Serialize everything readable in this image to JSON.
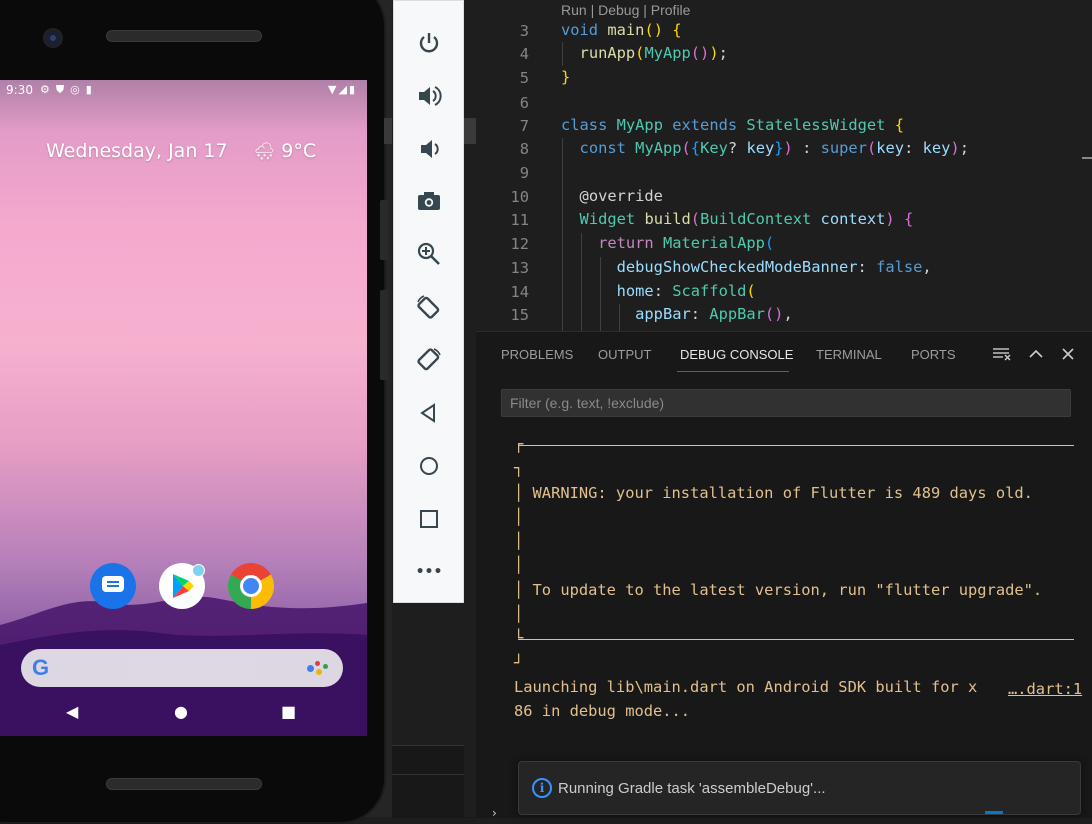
{
  "phone": {
    "status_bar": {
      "time": "9:30",
      "left_icons": [
        "settings-icon",
        "shield-icon",
        "sync-icon",
        "sdcard-icon"
      ],
      "right_icons": [
        "wifi-icon",
        "signal-icon",
        "battery-icon"
      ]
    },
    "date_text": "Wednesday, Jan 17",
    "weather_temp": "9°C",
    "weather_icon": "snow-cloud-icon",
    "dock_apps": [
      "Messages",
      "Play Store",
      "Chrome"
    ],
    "search_logo": "G",
    "nav_back": "◀",
    "nav_home": "●",
    "nav_recents": "■"
  },
  "emulator_toolbar": {
    "minimize": "−",
    "close": "×",
    "buttons": [
      "power",
      "volume-up",
      "volume-down",
      "screenshot",
      "zoom",
      "rotate-left",
      "rotate-right",
      "back",
      "home",
      "overview",
      "more"
    ],
    "more_label": "•••"
  },
  "editor": {
    "codelens": "Run | Debug | Profile",
    "lines": [
      {
        "n": "3"
      },
      {
        "n": "4"
      },
      {
        "n": "5"
      },
      {
        "n": "6"
      },
      {
        "n": "7"
      },
      {
        "n": "8"
      },
      {
        "n": "9"
      },
      {
        "n": "10"
      },
      {
        "n": "11"
      },
      {
        "n": "12"
      },
      {
        "n": "13"
      },
      {
        "n": "14"
      },
      {
        "n": "15"
      }
    ],
    "code": {
      "l3_kw": "void",
      "l3_fn": "main",
      "l3_rest": "()",
      "l3_br": "{",
      "l4_fn": "runApp",
      "l4_cls": "MyApp",
      "l4_end": ";",
      "l5": "}",
      "l7_kw1": "class",
      "l7_cls": "MyApp",
      "l7_kw2": "extends",
      "l7_cls2": "StatelessWidget",
      "l7_br": "{",
      "l8_kw": "const",
      "l8_cls": "MyApp",
      "l8_t": "Key",
      "l8_v": "key",
      "l8_sep": " : ",
      "l8_super": "super",
      "l8_param": "key",
      "l8_val": "key",
      "l10": "@override",
      "l11_cls": "Widget",
      "l11_fn": "build",
      "l11_t": "BuildContext",
      "l11_v": "context",
      "l11_br": "{",
      "l12_kw": "return",
      "l12_cls": "MaterialApp",
      "l13_param": "debugShowCheckedModeBanner",
      "l13_val": "false",
      "l14_param": "home",
      "l14_cls": "Scaffold",
      "l15_param": "appBar",
      "l15_cls": "AppBar"
    }
  },
  "panel": {
    "tabs": [
      "PROBLEMS",
      "OUTPUT",
      "DEBUG CONSOLE",
      "TERMINAL",
      "PORTS"
    ],
    "active_tab": "DEBUG CONSOLE",
    "filter_placeholder": "Filter (e.g. text, !exclude)",
    "console_lines": [
      "┌",
      "┐",
      "│ WARNING: your installation of Flutter is 489 days old.",
      "│",
      "│",
      "│",
      "│ To update to the latest version, run \"flutter upgrade\".",
      "│",
      "└",
      "┘",
      "Launching lib\\main.dart on Android SDK built for x",
      "86 in debug mode..."
    ],
    "console_link": "….dart:1",
    "toast_icon": "i",
    "toast_message": "Running Gradle task 'assembleDebug'..."
  }
}
